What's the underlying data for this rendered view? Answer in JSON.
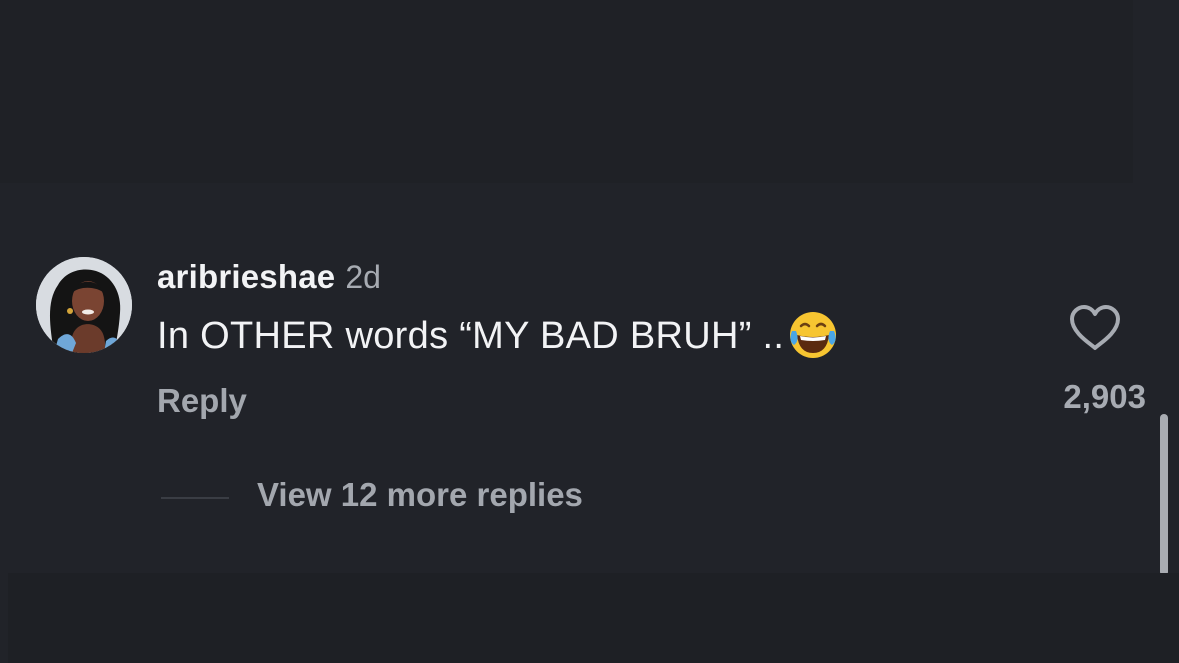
{
  "comment": {
    "username": "aribrieshae",
    "timestamp": "2d",
    "text": "In OTHER words “MY BAD BRUH” ..",
    "emoji": "face-with-tears-of-joy-icon",
    "reply_label": "Reply",
    "like_count": "2,903"
  },
  "replies": {
    "view_more_label": "View 12 more replies"
  },
  "colors": {
    "background": "#212329",
    "primary_text": "#f2f3f5",
    "secondary_text": "#a7abb2"
  },
  "icons": {
    "like": "heart-outline-icon",
    "avatar": "avatar"
  }
}
